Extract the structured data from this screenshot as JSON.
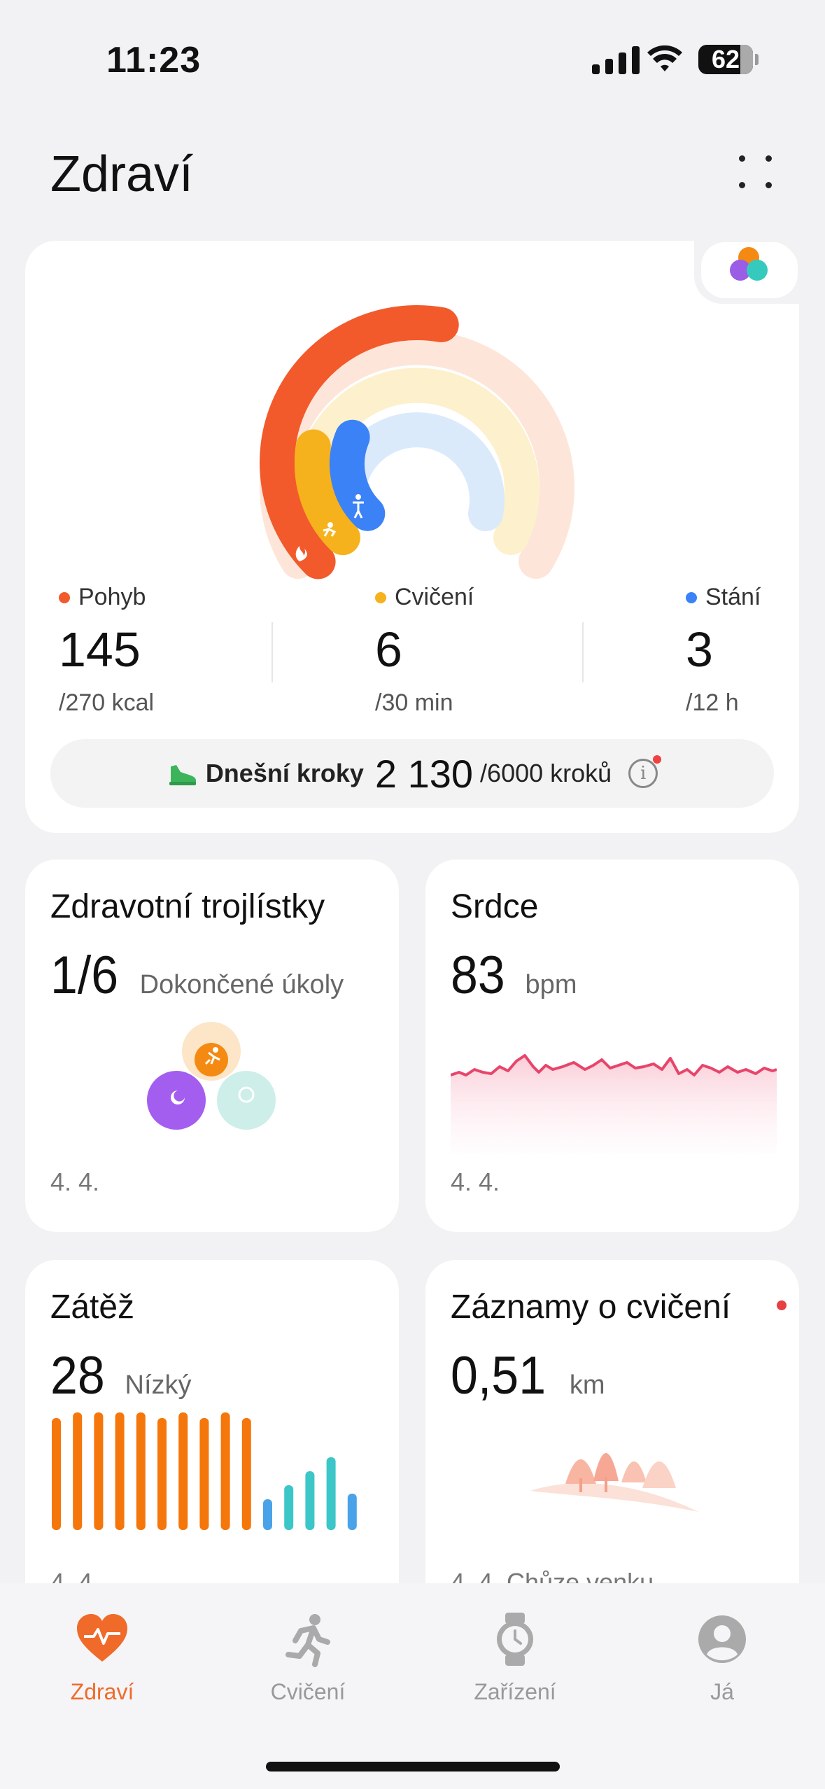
{
  "status_bar": {
    "time": "11:23",
    "battery": "62"
  },
  "header": {
    "title": "Zdraví"
  },
  "activity": {
    "move": {
      "label": "Pohyb",
      "value": "145",
      "goal": "/270 kcal",
      "color": "#f25a2b",
      "progress": 0.537
    },
    "exercise": {
      "label": "Cvičení",
      "value": "6",
      "goal": "/30 min",
      "color": "#f6b21c",
      "progress": 0.2
    },
    "stand": {
      "label": "Stání",
      "value": "3",
      "goal": "/12 h",
      "color": "#3b82f6",
      "progress": 0.25
    },
    "steps": {
      "label": "Dnešní kroky",
      "value": "2 130",
      "goal": "/6000 kroků"
    }
  },
  "cards": {
    "trefoil": {
      "title": "Zdravotní trojlístky",
      "value": "1/6",
      "unit": "Dokončené úkoly",
      "date": "4. 4."
    },
    "heart": {
      "title": "Srdce",
      "value": "83",
      "unit": "bpm",
      "date": "4. 4."
    },
    "stress": {
      "title": "Zátěž",
      "value": "28",
      "unit": "Nízký",
      "date": "4. 4."
    },
    "workouts": {
      "title": "Záznamy o cvičení",
      "value": "0,51",
      "unit": "km",
      "date": "4. 4. Chůze venku"
    }
  },
  "nav": {
    "items": [
      {
        "label": "Zdraví",
        "icon": "heart-icon",
        "active": true
      },
      {
        "label": "Cvičení",
        "icon": "running-icon",
        "active": false
      },
      {
        "label": "Zařízení",
        "icon": "watch-icon",
        "active": false
      },
      {
        "label": "Já",
        "icon": "profile-icon",
        "active": false
      }
    ]
  },
  "colors": {
    "accent": "#f06a2a",
    "heart_line": "#e8456b",
    "stress_high": "#f5760a",
    "stress_low_blue": "#4aa3e8",
    "stress_low_teal": "#3cc6c8"
  }
}
